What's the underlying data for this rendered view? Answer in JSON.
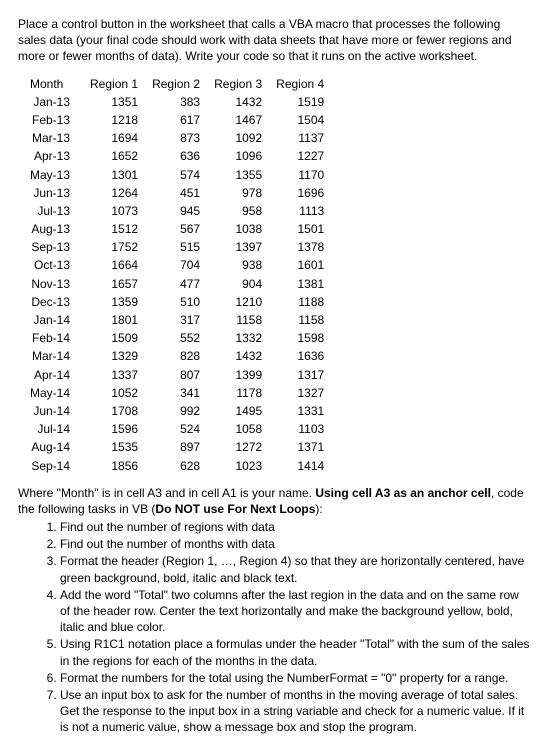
{
  "intro": "Place a control button in the worksheet that calls a VBA macro that processes the following sales data (your final code should work with data sheets that have more or fewer regions and more or fewer months of data). Write your code so that it runs on the active worksheet.",
  "headers": [
    "Month",
    "Region 1",
    "Region 2",
    "Region 3",
    "Region 4"
  ],
  "rows": [
    [
      "Jan-13",
      "1351",
      "383",
      "1432",
      "1519"
    ],
    [
      "Feb-13",
      "1218",
      "617",
      "1467",
      "1504"
    ],
    [
      "Mar-13",
      "1694",
      "873",
      "1092",
      "1137"
    ],
    [
      "Apr-13",
      "1652",
      "636",
      "1096",
      "1227"
    ],
    [
      "May-13",
      "1301",
      "574",
      "1355",
      "1170"
    ],
    [
      "Jun-13",
      "1264",
      "451",
      "978",
      "1696"
    ],
    [
      "Jul-13",
      "1073",
      "945",
      "958",
      "1113"
    ],
    [
      "Aug-13",
      "1512",
      "567",
      "1038",
      "1501"
    ],
    [
      "Sep-13",
      "1752",
      "515",
      "1397",
      "1378"
    ],
    [
      "Oct-13",
      "1664",
      "704",
      "938",
      "1601"
    ],
    [
      "Nov-13",
      "1657",
      "477",
      "904",
      "1381"
    ],
    [
      "Dec-13",
      "1359",
      "510",
      "1210",
      "1188"
    ],
    [
      "Jan-14",
      "1801",
      "317",
      "1158",
      "1158"
    ],
    [
      "Feb-14",
      "1509",
      "552",
      "1332",
      "1598"
    ],
    [
      "Mar-14",
      "1329",
      "828",
      "1432",
      "1636"
    ],
    [
      "Apr-14",
      "1337",
      "807",
      "1399",
      "1317"
    ],
    [
      "May-14",
      "1052",
      "341",
      "1178",
      "1327"
    ],
    [
      "Jun-14",
      "1708",
      "992",
      "1495",
      "1331"
    ],
    [
      "Jul-14",
      "1596",
      "524",
      "1058",
      "1103"
    ],
    [
      "Aug-14",
      "1535",
      "897",
      "1272",
      "1371"
    ],
    [
      "Sep-14",
      "1856",
      "628",
      "1023",
      "1414"
    ]
  ],
  "outro_prefix": "Where \"Month\" is in cell A3 and in cell A1 is your name. ",
  "outro_bold1": "Using cell A3 as an anchor cell",
  "outro_mid": ", code the following tasks in VB (",
  "outro_bold2": "Do NOT use For Next Loops",
  "outro_suffix": "):",
  "tasks": {
    "1": "Find out the number of regions with data",
    "2": "Find out the number of months with data",
    "3": "Format the header (Region 1, …, Region 4) so that they are horizontally centered, have green background, bold, italic and black text.",
    "4": "Add the word \"Total\" two columns after the last region in the data and on the same row of the header row. Center the text horizontally and make the background yellow, bold, italic and blue color.",
    "5": "Using R1C1 notation place a formulas under the header \"Total\" with the sum of the sales in the regions for each of the months in the data.",
    "6": "Format the numbers for the total using the NumberFormat = \"0\" property for a range.",
    "7": "Use an input box to ask for the number of months in the moving average of total sales. Get the response to the input box in a string variable and check for a numeric value. If it is not a numeric value, show a message box and stop the program."
  }
}
